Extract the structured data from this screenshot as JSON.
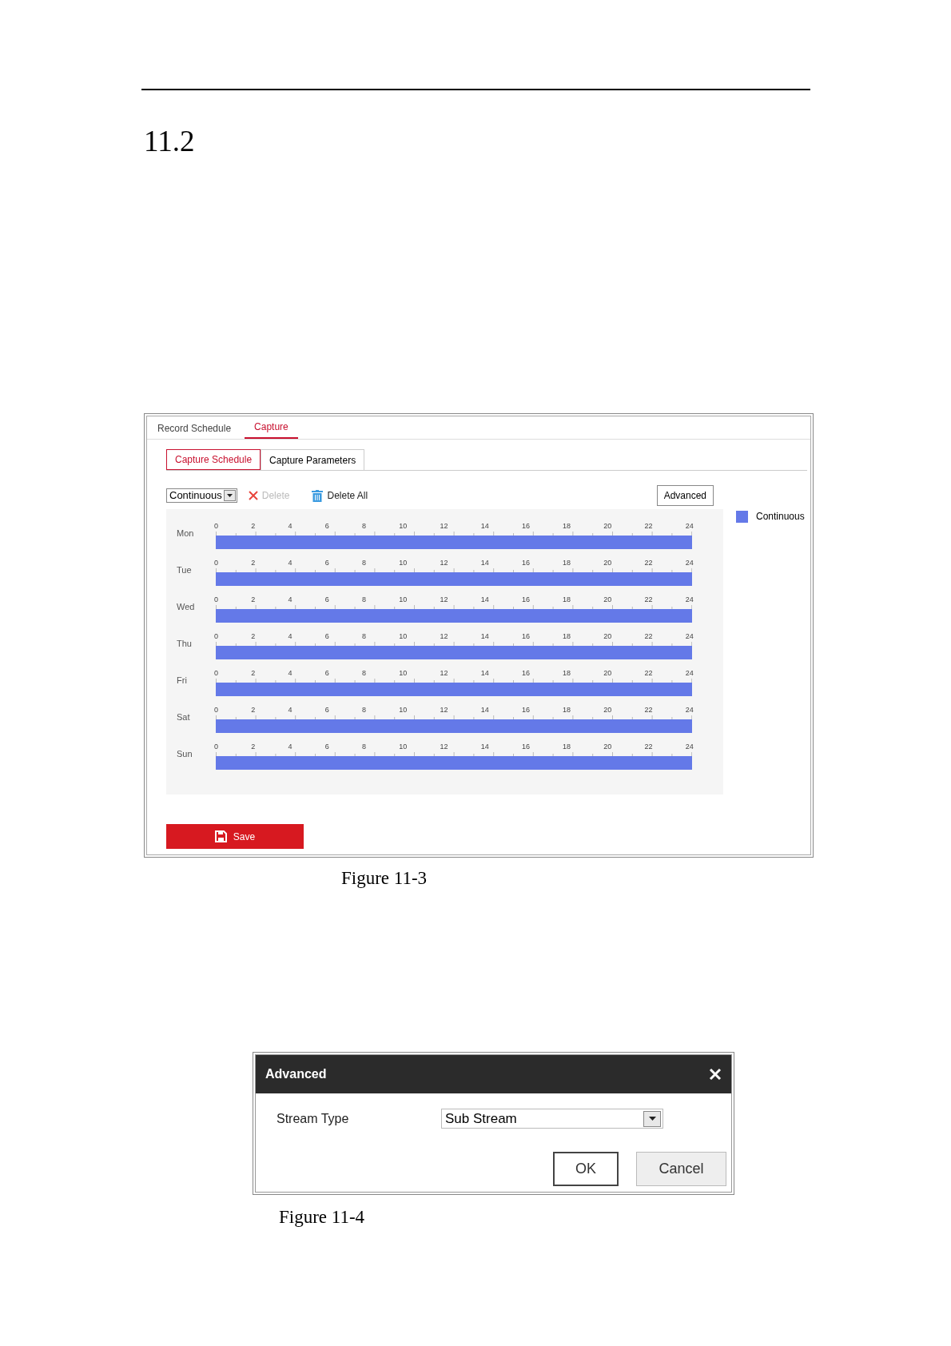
{
  "section": {
    "number": "11.2"
  },
  "figure_1": {
    "tabs": [
      {
        "label": "Record Schedule",
        "selected": false
      },
      {
        "label": "Capture",
        "selected": true
      }
    ],
    "subtabs": [
      {
        "label": "Capture Schedule",
        "selected": true
      },
      {
        "label": "Capture Parameters",
        "selected": false
      }
    ],
    "toolbar": {
      "type_select": "Continuous",
      "actions": [
        {
          "label": "Delete",
          "disabled": true,
          "kind": "delete"
        },
        {
          "label": "Delete All",
          "disabled": false,
          "kind": "delete_all"
        }
      ],
      "advanced_button": "Advanced"
    },
    "schedule": [
      {
        "day": "Mon",
        "ticks": [
          "0",
          "2",
          "4",
          "6",
          "8",
          "10",
          "12",
          "14",
          "16",
          "18",
          "20",
          "22",
          "24"
        ],
        "level": 1
      },
      {
        "day": "Tue",
        "ticks": [
          "0",
          "2",
          "4",
          "6",
          "8",
          "10",
          "12",
          "14",
          "16",
          "18",
          "20",
          "22",
          "24"
        ],
        "level": 1
      },
      {
        "day": "Wed",
        "ticks": [
          "0",
          "2",
          "4",
          "6",
          "8",
          "10",
          "12",
          "14",
          "16",
          "18",
          "20",
          "22",
          "24"
        ],
        "level": 1
      },
      {
        "day": "Thu",
        "ticks": [
          "0",
          "2",
          "4",
          "6",
          "8",
          "10",
          "12",
          "14",
          "16",
          "18",
          "20",
          "22",
          "24"
        ],
        "level": 1
      },
      {
        "day": "Fri",
        "ticks": [
          "0",
          "2",
          "4",
          "6",
          "8",
          "10",
          "12",
          "14",
          "16",
          "18",
          "20",
          "22",
          "24"
        ],
        "level": 1
      },
      {
        "day": "Sat",
        "ticks": [
          "0",
          "2",
          "4",
          "6",
          "8",
          "10",
          "12",
          "14",
          "16",
          "18",
          "20",
          "22",
          "24"
        ],
        "level": 1
      },
      {
        "day": "Sun",
        "ticks": [
          "0",
          "2",
          "4",
          "6",
          "8",
          "10",
          "12",
          "14",
          "16",
          "18",
          "20",
          "22",
          "24"
        ],
        "level": 1
      }
    ],
    "legend": [
      {
        "label": "Continuous",
        "color": "#6479e8"
      }
    ],
    "save_button": "Save",
    "caption": "Figure 11-3"
  },
  "figure_2": {
    "dialog": {
      "title": "Advanced",
      "field_label": "Stream Type",
      "select_value": "Sub Stream",
      "buttons": [
        {
          "label": "OK",
          "kind": "primary"
        },
        {
          "label": "Cancel",
          "kind": "secondary"
        }
      ]
    },
    "caption": "Figure 11-4"
  }
}
